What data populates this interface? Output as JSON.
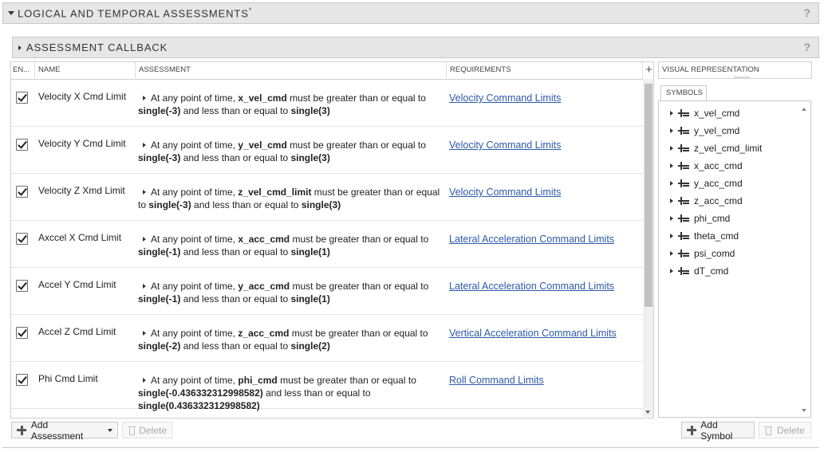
{
  "panel": {
    "title": "LOGICAL AND TEMPORAL ASSESSMENTS",
    "modified_marker": "*",
    "help": "?"
  },
  "callback": {
    "title": "ASSESSMENT CALLBACK",
    "help": "?"
  },
  "table": {
    "headers": {
      "enabled": "EN...",
      "name": "NAME",
      "assessment": "ASSESSMENT",
      "requirements": "REQUIREMENTS",
      "add": "+"
    },
    "rows": [
      {
        "name": "Velocity X Cmd Limit",
        "prefix": "At any point of time,",
        "signal": "x_vel_cmd",
        "mid1": "must be greater than or equal to",
        "low": "single(-3)",
        "mid2": "and less than or equal to",
        "high": "single(3)",
        "requirement": "Velocity Command Limits"
      },
      {
        "name": "Velocity Y Cmd Limit",
        "prefix": "At any point of time,",
        "signal": "y_vel_cmd",
        "mid1": "must be greater than or equal to",
        "low": "single(-3)",
        "mid2": "and less than or equal to",
        "high": "single(3)",
        "requirement": "Velocity Command Limits"
      },
      {
        "name": "Velocity Z Xmd Limit",
        "prefix": "At any point of time,",
        "signal": "z_vel_cmd_limit",
        "mid1": "must be greater than or equal to",
        "low": "single(-3)",
        "mid2": "and less than or equal to",
        "high": "single(3)",
        "requirement": "Velocity Command Limits"
      },
      {
        "name": "Axccel X Cmd Limit",
        "prefix": "At any point of time,",
        "signal": "x_acc_cmd",
        "mid1": "must be greater than or equal to",
        "low": "single(-1)",
        "mid2": "and less than or equal to",
        "high": "single(1)",
        "requirement": "Lateral Acceleration Command Limits"
      },
      {
        "name": "Accel Y Cmd Limit",
        "prefix": "At any point of time,",
        "signal": "y_acc_cmd",
        "mid1": "must be greater than or equal to",
        "low": "single(-1)",
        "mid2": "and less than or equal to",
        "high": "single(1)",
        "requirement": "Lateral Acceleration Command Limits"
      },
      {
        "name": "Accel Z Cmd Limit",
        "prefix": "At any point of time,",
        "signal": "z_acc_cmd",
        "mid1": "must be greater than or equal to",
        "low": "single(-2)",
        "mid2": "and less than or equal to",
        "high": "single(2)",
        "requirement": "Vertical Acceleration Command Limits"
      },
      {
        "name": "Phi Cmd Limit",
        "prefix": "At any point of time,",
        "signal": "phi_cmd",
        "mid1": "must be greater than or equal to",
        "low": "single(-0.436332312998582)",
        "mid2": "and less than or equal to",
        "high": "single(0.436332312998582)",
        "requirement": "Roll Command Limits"
      }
    ]
  },
  "visual": {
    "header": "VISUAL REPRESENTATION",
    "tab": "SYMBOLS",
    "symbols": [
      "x_vel_cmd",
      "y_vel_cmd",
      "z_vel_cmd_limit",
      "x_acc_cmd",
      "y_acc_cmd",
      "z_acc_cmd",
      "phi_cmd",
      "theta_cmd",
      "psi_comd",
      "dT_cmd"
    ]
  },
  "buttons": {
    "add_assessment": "Add Assessment",
    "delete_assessment": "Delete",
    "add_symbol": "Add Symbol",
    "delete_symbol": "Delete"
  }
}
